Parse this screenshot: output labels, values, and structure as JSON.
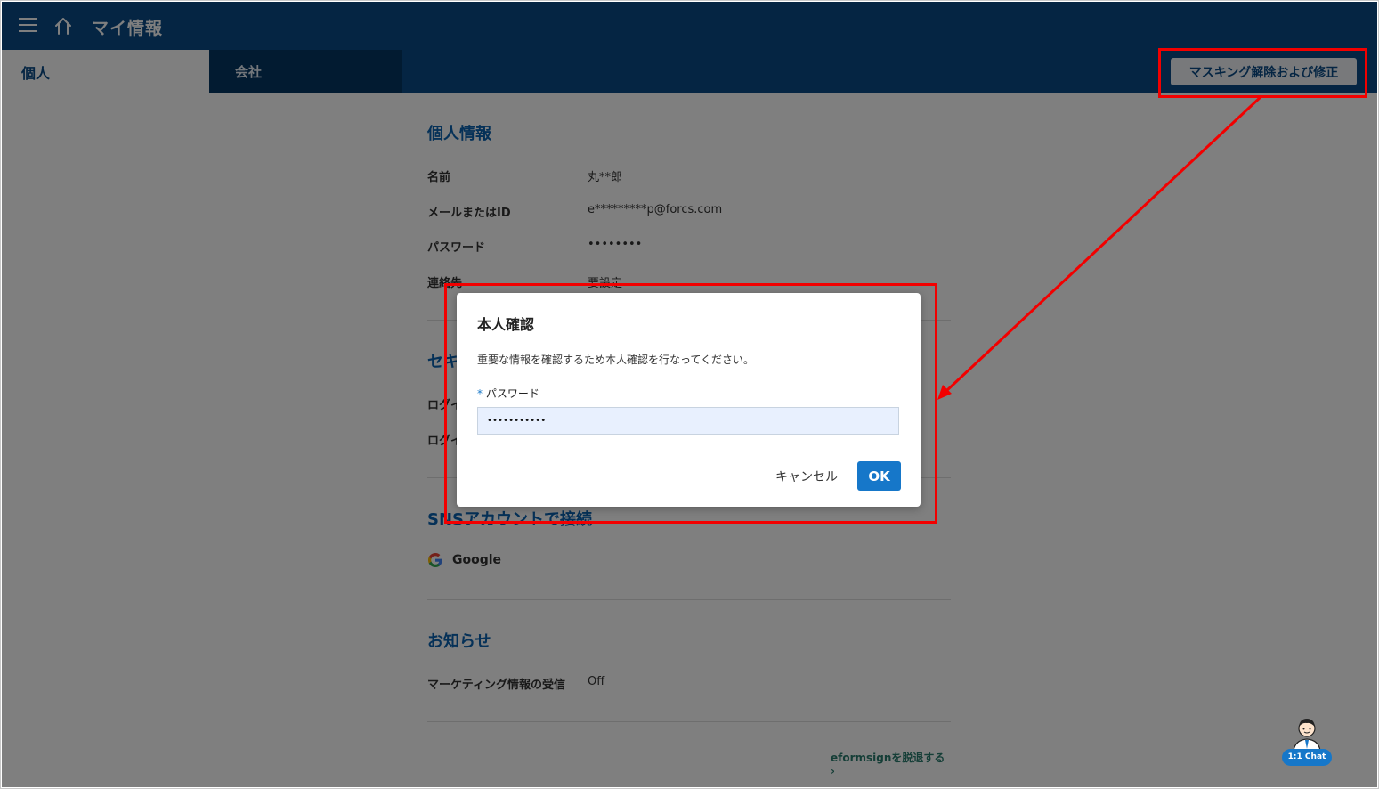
{
  "header": {
    "title": "マイ情報"
  },
  "tabs": [
    {
      "label": "個人"
    },
    {
      "label": "会社"
    }
  ],
  "toolbar": {
    "unmask_label": "マスキング解除および修正"
  },
  "personal": {
    "title": "個人情報",
    "rows": [
      {
        "label": "名前",
        "value": "丸**郎"
      },
      {
        "label": "メールまたはID",
        "value": "e*********p@forcs.com"
      },
      {
        "label": "パスワード",
        "value": "••••••••"
      },
      {
        "label": "連絡先",
        "value": "要設定"
      }
    ]
  },
  "security": {
    "title_partial": "セキ",
    "rows_partial": [
      "ログイ",
      "ログイ"
    ]
  },
  "sns": {
    "title": "SNSアカウントで接続",
    "google_label": "Google"
  },
  "notice": {
    "title": "お知らせ",
    "marketing_label": "マーケティング情報の受信",
    "marketing_value": "Off"
  },
  "leave_link": "eformsignを脱退する ›",
  "chat": {
    "label": "1:1 Chat"
  },
  "modal": {
    "title": "本人確認",
    "description": "重要な情報を確認するため本人確認を行なってください。",
    "required_mark": "*",
    "password_label": "パスワード",
    "password_value": "•••••••••••",
    "cancel_label": "キャンセル",
    "ok_label": "OK"
  },
  "colors": {
    "header_bg": "#0b4b86",
    "accent": "#1677c9",
    "annotation": "#f20000"
  }
}
